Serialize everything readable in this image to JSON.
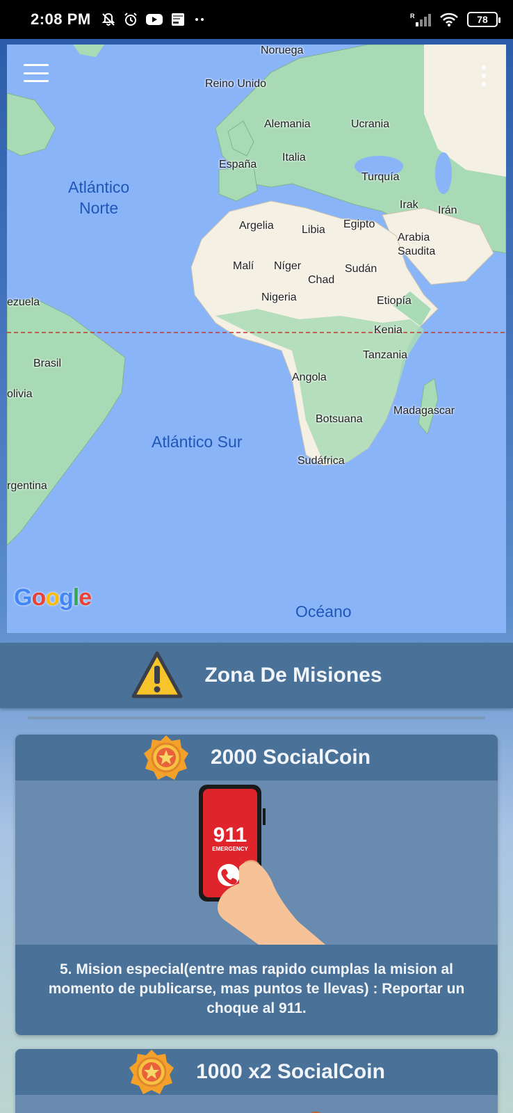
{
  "status_bar": {
    "time": "2:08 PM",
    "battery": "78",
    "left_icons": [
      "mute-bell-icon",
      "alarm-icon",
      "youtube-icon",
      "notification-preview-icon",
      "more-dots-icon"
    ],
    "right_icons": [
      "signal-icon",
      "wifi-icon",
      "battery-icon"
    ]
  },
  "map": {
    "provider": "Google",
    "oceans": [
      {
        "name": "Atlántico\nNorte"
      },
      {
        "name": "Atlántico Sur"
      },
      {
        "name": "Océano"
      }
    ],
    "countries": [
      "Noruega",
      "Reino Unido",
      "Alemania",
      "Ucrania",
      "Italia",
      "España",
      "Turquía",
      "Irak",
      "Irán",
      "Argelia",
      "Libia",
      "Egipto",
      "Arabia\nSaudita",
      "Malí",
      "Níger",
      "Sudán",
      "Chad",
      "Nigeria",
      "Etiopía",
      "ezuela",
      "Kenia",
      "Tanzania",
      "Brasil",
      "olivia",
      "Angola",
      "Madagascar",
      "Botsuana",
      "Sudáfrica",
      "rgentina"
    ],
    "colors": {
      "ocean": "#8ab4f8",
      "land": "#a8dab5",
      "desert": "#f5f0e4",
      "equator": "#c0392b"
    }
  },
  "mission_zone": {
    "title": "Zona De Misiones",
    "icon": "warning-icon"
  },
  "missions": [
    {
      "coins": "2000 SocialCoin",
      "icon": "medal-star-icon",
      "image": "phone-911-emergency",
      "phone_number": "911",
      "phone_caption": "EMERGENCY",
      "description": "5. Mision especial(entre mas rapido cumplas la mision al momento de publicarse, mas puntos te llevas) : Reportar un choque al 911."
    },
    {
      "coins": "1000 x2 SocialCoin",
      "icon": "medal-star-icon"
    }
  ]
}
